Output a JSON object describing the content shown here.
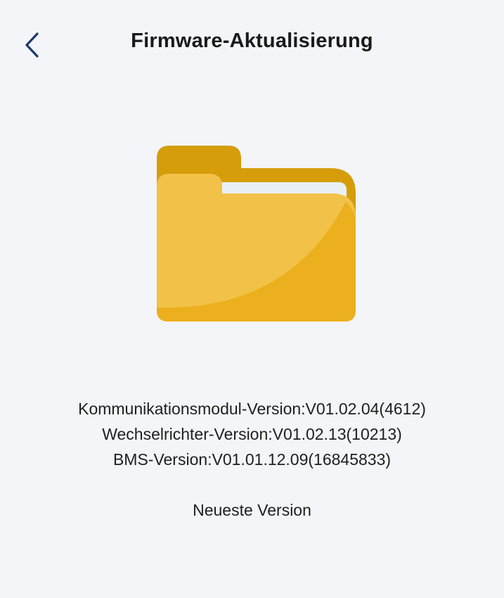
{
  "header": {
    "title": "Firmware-Aktualisierung",
    "back_icon": "chevron-left-icon"
  },
  "illustration": {
    "icon": "folder-icon",
    "colors": {
      "back": "#d59d0a",
      "paper": "#e8f0f6",
      "front": "#f1c247",
      "front_shade": "#ecaf1d"
    }
  },
  "versions": {
    "communication_module": "Kommunikationsmodul-Version:V01.02.04(4612)",
    "inverter": "Wechselrichter-Version:V01.02.13(10213)",
    "bms": "BMS-Version:V01.01.12.09(16845833)"
  },
  "status": {
    "text": "Neueste Version"
  },
  "colors": {
    "background": "#f4f5f9",
    "accent": "#1b3a6b",
    "text": "#1f1f1f"
  }
}
